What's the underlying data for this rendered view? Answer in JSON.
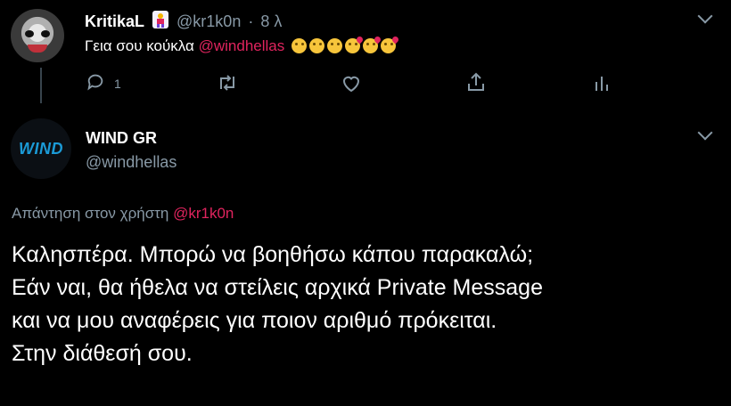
{
  "tweet1": {
    "display_name": "KritikaL",
    "handle": "@kr1k0n",
    "separator": "·",
    "time": "8 λ",
    "text": "Γεια σου κούκλα",
    "mention": "@windhellas",
    "emojis": [
      "wink-face",
      "wink-face",
      "wink-face",
      "kiss-face",
      "kiss-face",
      "kiss-face"
    ],
    "reply_count": "1"
  },
  "tweet2": {
    "display_name": "WIND GR",
    "handle": "@windhellas",
    "logo_text": "WIND",
    "reply_prefix": "Απάντηση στον χρήστη",
    "reply_mention": "@kr1k0n",
    "body_lines": [
      "Καλησπέρα. Μπορώ να βοηθήσω κάπου παρακαλώ;",
      "Εάν ναι, θα ήθελα να στείλεις αρχικά Private Message",
      "και να μου αναφέρεις για ποιον αριθμό πρόκειται.",
      "Στην διάθεσή σου."
    ]
  },
  "colors": {
    "background": "#000000",
    "muted": "#8899a6",
    "accent": "#e0245e",
    "brand": "#1b9ad6"
  }
}
